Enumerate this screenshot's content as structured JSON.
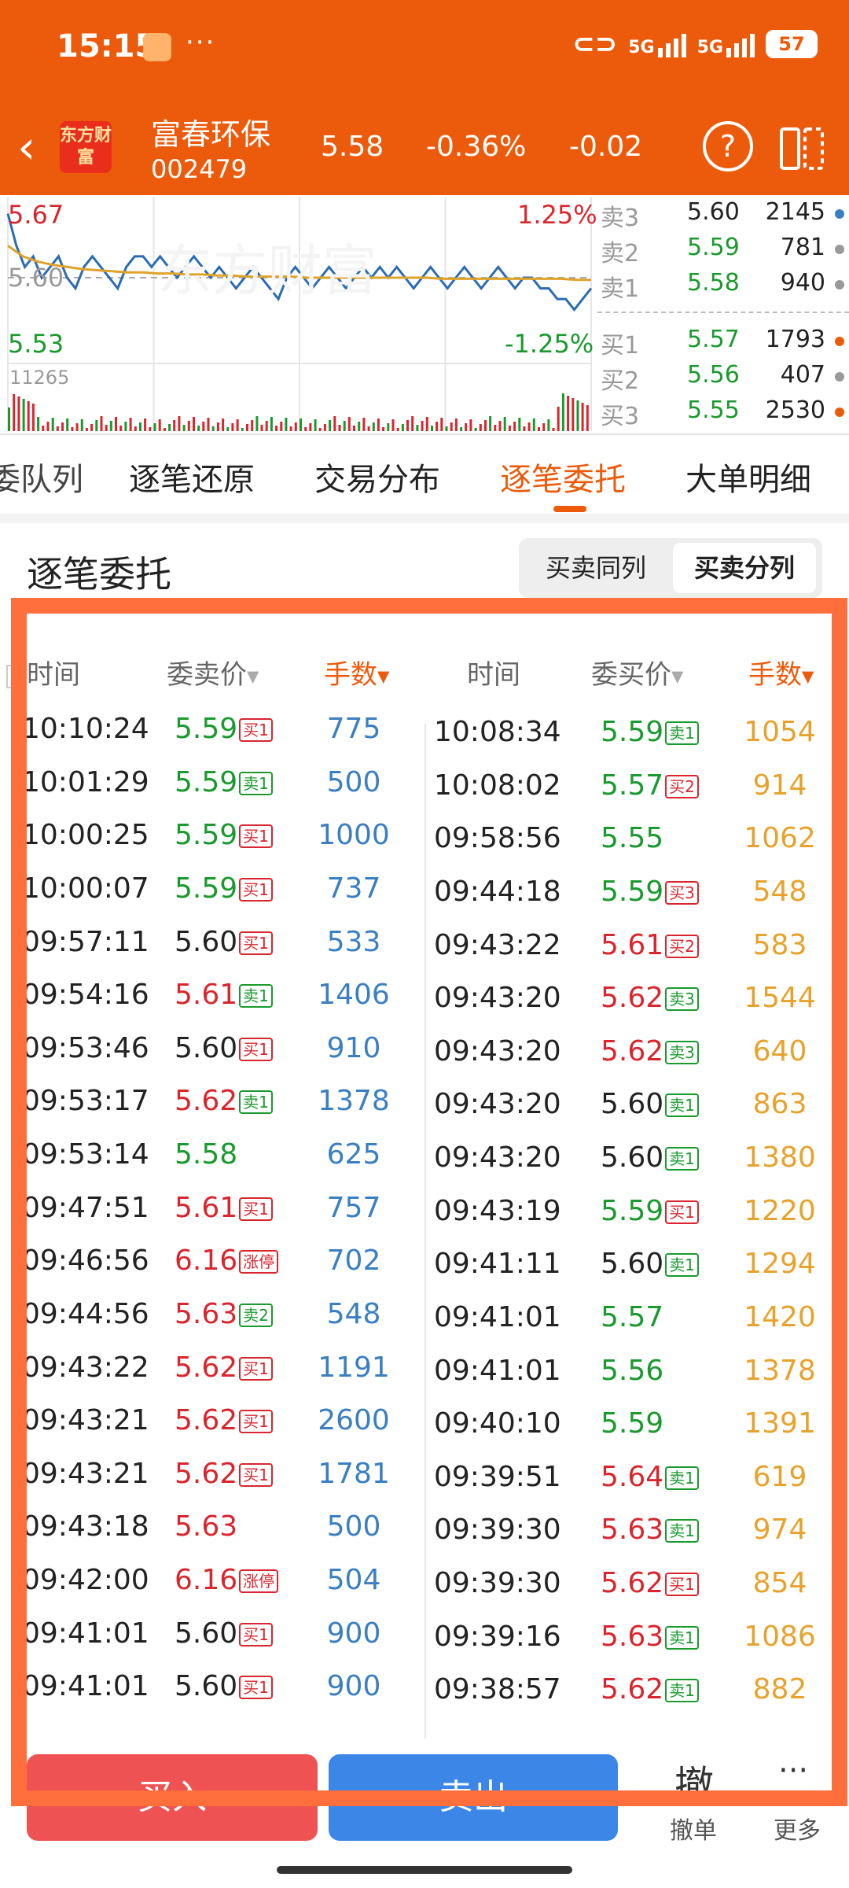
{
  "status": {
    "time": "15:15",
    "battery": "57",
    "net1": "5G",
    "net2": "5G"
  },
  "header": {
    "logo": "东方财富",
    "name": "富春环保",
    "code": "002479",
    "price": "5.58",
    "pct": "-0.36%",
    "change": "-0.02"
  },
  "chart": {
    "high_price": "5.67",
    "mid_price": "5.60",
    "low_price": "5.53",
    "high_pct": "1.25%",
    "low_pct": "-1.25%",
    "volume_max": "11265",
    "watermark": "东方财富"
  },
  "chart_data": {
    "type": "line",
    "ylim": [
      5.53,
      5.67
    ],
    "series": [
      {
        "values": [
          5.66,
          5.63,
          5.61,
          5.62,
          5.6,
          5.61,
          5.62,
          5.6,
          5.59,
          5.61,
          5.62,
          5.61,
          5.6,
          5.59,
          5.61,
          5.62,
          5.62,
          5.61,
          5.62,
          5.61,
          5.6,
          5.61,
          5.62,
          5.61,
          5.6,
          5.61,
          5.6,
          5.59,
          5.6,
          5.61,
          5.6,
          5.59,
          5.58,
          5.6,
          5.61,
          5.6,
          5.59,
          5.6,
          5.61,
          5.6,
          5.59,
          5.6,
          5.61,
          5.6,
          5.61,
          5.6,
          5.61,
          5.6,
          5.59,
          5.6,
          5.61,
          5.6,
          5.59,
          5.6,
          5.61,
          5.6,
          5.59,
          5.6,
          5.61,
          5.6,
          5.59,
          5.6,
          5.6,
          5.59,
          5.59,
          5.58,
          5.58,
          5.57,
          5.58,
          5.59
        ]
      },
      {
        "values": [
          5.63,
          5.62,
          5.615,
          5.612,
          5.61,
          5.608,
          5.607,
          5.606,
          5.605,
          5.605,
          5.604,
          5.604,
          5.603,
          5.603,
          5.602,
          5.602,
          5.601,
          5.601,
          5.601,
          5.601,
          5.6,
          5.6,
          5.6,
          5.6,
          5.6,
          5.6,
          5.6,
          5.6,
          5.6,
          5.599,
          5.599,
          5.599,
          5.599,
          5.599,
          5.599,
          5.599,
          5.599,
          5.599,
          5.598,
          5.598
        ]
      }
    ]
  },
  "orderbook": {
    "sell": [
      {
        "tag": "卖3",
        "price": "5.60",
        "vol": "2145",
        "dot": "#3a7fc2",
        "pc": "black"
      },
      {
        "tag": "卖2",
        "price": "5.59",
        "vol": "781",
        "dot": "#999999",
        "pc": "green"
      },
      {
        "tag": "卖1",
        "price": "5.58",
        "vol": "940",
        "dot": "#999999",
        "pc": "green"
      }
    ],
    "buy": [
      {
        "tag": "买1",
        "price": "5.57",
        "vol": "1793",
        "dot": "#ec5b0c",
        "pc": "green"
      },
      {
        "tag": "买2",
        "price": "5.56",
        "vol": "407",
        "dot": "#999999",
        "pc": "green"
      },
      {
        "tag": "买3",
        "price": "5.55",
        "vol": "2530",
        "dot": "#ec5b0c",
        "pc": "green"
      }
    ]
  },
  "tabs": [
    "委队列",
    "逐笔还原",
    "交易分布",
    "逐笔委托",
    "大单明细"
  ],
  "active_tab": "逐笔委托",
  "section": {
    "title": "逐笔委托",
    "toggle_a": "买卖同列",
    "toggle_b": "买卖分列"
  },
  "table": {
    "headers_left": {
      "time": "时间",
      "price": "委卖价",
      "vol": "手数"
    },
    "headers_right": {
      "time": "时间",
      "price": "委买价",
      "vol": "手数"
    },
    "left": [
      {
        "time": "10:10:24",
        "price": "5.59",
        "pc": "green",
        "badge": "买1",
        "bc": "red",
        "vol": "775"
      },
      {
        "time": "10:01:29",
        "price": "5.59",
        "pc": "green",
        "badge": "卖1",
        "bc": "green",
        "vol": "500"
      },
      {
        "time": "10:00:25",
        "price": "5.59",
        "pc": "green",
        "badge": "买1",
        "bc": "red",
        "vol": "1000"
      },
      {
        "time": "10:00:07",
        "price": "5.59",
        "pc": "green",
        "badge": "买1",
        "bc": "red",
        "vol": "737"
      },
      {
        "time": "09:57:11",
        "price": "5.60",
        "pc": "black",
        "badge": "买1",
        "bc": "red",
        "vol": "533"
      },
      {
        "time": "09:54:16",
        "price": "5.61",
        "pc": "red",
        "badge": "卖1",
        "bc": "green",
        "vol": "1406"
      },
      {
        "time": "09:53:46",
        "price": "5.60",
        "pc": "black",
        "badge": "买1",
        "bc": "red",
        "vol": "910"
      },
      {
        "time": "09:53:17",
        "price": "5.62",
        "pc": "red",
        "badge": "卖1",
        "bc": "green",
        "vol": "1378"
      },
      {
        "time": "09:53:14",
        "price": "5.58",
        "pc": "green",
        "badge": "",
        "bc": "",
        "vol": "625"
      },
      {
        "time": "09:47:51",
        "price": "5.61",
        "pc": "red",
        "badge": "买1",
        "bc": "red",
        "vol": "757"
      },
      {
        "time": "09:46:56",
        "price": "6.16",
        "pc": "red",
        "badge": "涨停",
        "bc": "red",
        "vol": "702"
      },
      {
        "time": "09:44:56",
        "price": "5.63",
        "pc": "red",
        "badge": "卖2",
        "bc": "green",
        "vol": "548"
      },
      {
        "time": "09:43:22",
        "price": "5.62",
        "pc": "red",
        "badge": "买1",
        "bc": "red",
        "vol": "1191"
      },
      {
        "time": "09:43:21",
        "price": "5.62",
        "pc": "red",
        "badge": "买1",
        "bc": "red",
        "vol": "2600"
      },
      {
        "time": "09:43:21",
        "price": "5.62",
        "pc": "red",
        "badge": "买1",
        "bc": "red",
        "vol": "1781"
      },
      {
        "time": "09:43:18",
        "price": "5.63",
        "pc": "red",
        "badge": "",
        "bc": "",
        "vol": "500"
      },
      {
        "time": "09:42:00",
        "price": "6.16",
        "pc": "red",
        "badge": "涨停",
        "bc": "red",
        "vol": "504"
      },
      {
        "time": "09:41:01",
        "price": "5.60",
        "pc": "black",
        "badge": "买1",
        "bc": "red",
        "vol": "900"
      },
      {
        "time": "09:41:01",
        "price": "5.60",
        "pc": "black",
        "badge": "买1",
        "bc": "red",
        "vol": "900"
      }
    ],
    "right": [
      {
        "time": "10:08:34",
        "price": "5.59",
        "pc": "green",
        "badge": "卖1",
        "bc": "green",
        "vol": "1054"
      },
      {
        "time": "10:08:02",
        "price": "5.57",
        "pc": "green",
        "badge": "买2",
        "bc": "red",
        "vol": "914"
      },
      {
        "time": "09:58:56",
        "price": "5.55",
        "pc": "green",
        "badge": "",
        "bc": "",
        "vol": "1062"
      },
      {
        "time": "09:44:18",
        "price": "5.59",
        "pc": "green",
        "badge": "买3",
        "bc": "red",
        "vol": "548"
      },
      {
        "time": "09:43:22",
        "price": "5.61",
        "pc": "red",
        "badge": "买2",
        "bc": "red",
        "vol": "583"
      },
      {
        "time": "09:43:20",
        "price": "5.62",
        "pc": "red",
        "badge": "卖3",
        "bc": "green",
        "vol": "1544"
      },
      {
        "time": "09:43:20",
        "price": "5.62",
        "pc": "red",
        "badge": "卖3",
        "bc": "green",
        "vol": "640"
      },
      {
        "time": "09:43:20",
        "price": "5.60",
        "pc": "black",
        "badge": "卖1",
        "bc": "green",
        "vol": "863"
      },
      {
        "time": "09:43:20",
        "price": "5.60",
        "pc": "black",
        "badge": "卖1",
        "bc": "green",
        "vol": "1380"
      },
      {
        "time": "09:43:19",
        "price": "5.59",
        "pc": "green",
        "badge": "买1",
        "bc": "red",
        "vol": "1220"
      },
      {
        "time": "09:41:11",
        "price": "5.60",
        "pc": "black",
        "badge": "卖1",
        "bc": "green",
        "vol": "1294"
      },
      {
        "time": "09:41:01",
        "price": "5.57",
        "pc": "green",
        "badge": "",
        "bc": "",
        "vol": "1420"
      },
      {
        "time": "09:41:01",
        "price": "5.56",
        "pc": "green",
        "badge": "",
        "bc": "",
        "vol": "1378"
      },
      {
        "time": "09:40:10",
        "price": "5.59",
        "pc": "green",
        "badge": "",
        "bc": "",
        "vol": "1391"
      },
      {
        "time": "09:39:51",
        "price": "5.64",
        "pc": "red",
        "badge": "卖1",
        "bc": "green",
        "vol": "619"
      },
      {
        "time": "09:39:30",
        "price": "5.63",
        "pc": "red",
        "badge": "卖1",
        "bc": "green",
        "vol": "974"
      },
      {
        "time": "09:39:30",
        "price": "5.62",
        "pc": "red",
        "badge": "买1",
        "bc": "red",
        "vol": "854"
      },
      {
        "time": "09:39:16",
        "price": "5.63",
        "pc": "red",
        "badge": "卖1",
        "bc": "green",
        "vol": "1086"
      },
      {
        "time": "09:38:57",
        "price": "5.62",
        "pc": "red",
        "badge": "卖1",
        "bc": "green",
        "vol": "882"
      }
    ]
  },
  "bottom": {
    "buy": "买入",
    "sell": "卖出",
    "cancel_icon": "撤",
    "cancel": "撤单",
    "more_icon": "···",
    "more": "更多"
  }
}
